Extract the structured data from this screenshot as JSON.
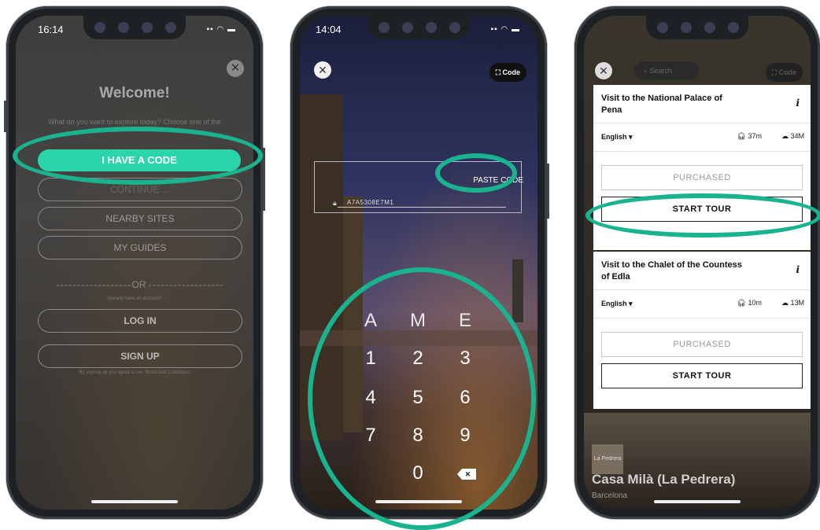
{
  "screen1": {
    "time": "16:14",
    "title": "Welcome!",
    "prompt": "What do you want to explore today? Choose one of the",
    "primary_button": "I HAVE A CODE",
    "continue_button": "CONTINUE ...",
    "nearby_button": "NEARBY SITES",
    "guides_button": "MY GUIDES",
    "or_label": "OR",
    "already_account": "Already have an account?",
    "login_button": "LOG IN",
    "signup_button": "SIGN UP",
    "terms": "By signing up you agree to our Terms and Conditions"
  },
  "screen2": {
    "time": "14:04",
    "code_button": "Code",
    "paste_label": "PASTE CODE",
    "code_value": "A7A5308E7M1",
    "letters": [
      "A",
      "M",
      "E"
    ],
    "digits": [
      "1",
      "2",
      "3",
      "4",
      "5",
      "6",
      "7",
      "8",
      "9",
      "0"
    ],
    "backspace": "✕"
  },
  "screen3": {
    "search_placeholder": "Search",
    "code_button": "Code",
    "tours": [
      {
        "title": "Visit to the National Palace of Pena",
        "language": "English",
        "duration": "37m",
        "size": "34M",
        "purchased": "PURCHASED",
        "start": "START TOUR"
      },
      {
        "title": "Visit to the Chalet of the Countess of Edla",
        "language": "English",
        "duration": "10m",
        "size": "13M",
        "purchased": "PURCHASED",
        "start": "START TOUR"
      }
    ],
    "place_label": "La Pedrera",
    "bottom_title": "Casa Milà (La Pedrera)",
    "bottom_subtitle": "Barcelona"
  },
  "colors": {
    "accent": "#2ad6a9",
    "highlight_ring": "#19b38f"
  }
}
